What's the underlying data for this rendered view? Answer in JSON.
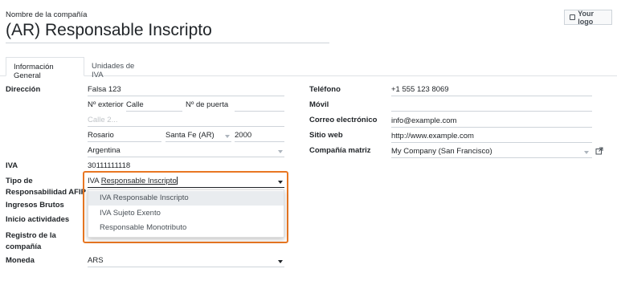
{
  "header": {
    "company_name_label": "Nombre de la compañía",
    "company_name": "(AR) Responsable Inscripto",
    "logo_button": "Your logo"
  },
  "tabs": [
    {
      "label": "Información General",
      "active": true
    },
    {
      "label": "Unidades de IVA",
      "active": false
    }
  ],
  "left": {
    "direccion_label": "Dirección",
    "street": "Falsa 123",
    "nro_exterior_label": "Nº exterior",
    "nro_exterior_value": "Calle",
    "nro_puerta_label": "Nº de puerta",
    "street2_placeholder": "Calle 2...",
    "city": "Rosario",
    "state": "Santa Fe (AR)",
    "zip": "2000",
    "country": "Argentina",
    "iva_label": "IVA",
    "iva_value": "30111111118",
    "tipo_resp_label_1": "Tipo de",
    "tipo_resp_label_2": "Responsabilidad AFIP",
    "tipo_resp_input_prefix": "IVA ",
    "tipo_resp_input_underlined": "Responsable Inscripto",
    "ingresos_label": "Ingresos Brutos",
    "inicio_label": "Inicio actividades",
    "registro_label_1": "Registro de la",
    "registro_label_2": "compañía",
    "moneda_label": "Moneda",
    "moneda_value": "ARS"
  },
  "dropdown": {
    "options": [
      "IVA Responsable Inscripto",
      "IVA Sujeto Exento",
      "Responsable Monotributo"
    ],
    "highlight_color": "#e87722"
  },
  "right": {
    "telefono_label": "Teléfono",
    "telefono_value": "+1 555 123 8069",
    "movil_label": "Móvil",
    "correo_label": "Correo electrónico",
    "correo_value": "info@example.com",
    "sitio_label": "Sitio web",
    "sitio_value": "http://www.example.com",
    "matriz_label": "Compañía matriz",
    "matriz_value": "My Company (San Francisco)"
  }
}
